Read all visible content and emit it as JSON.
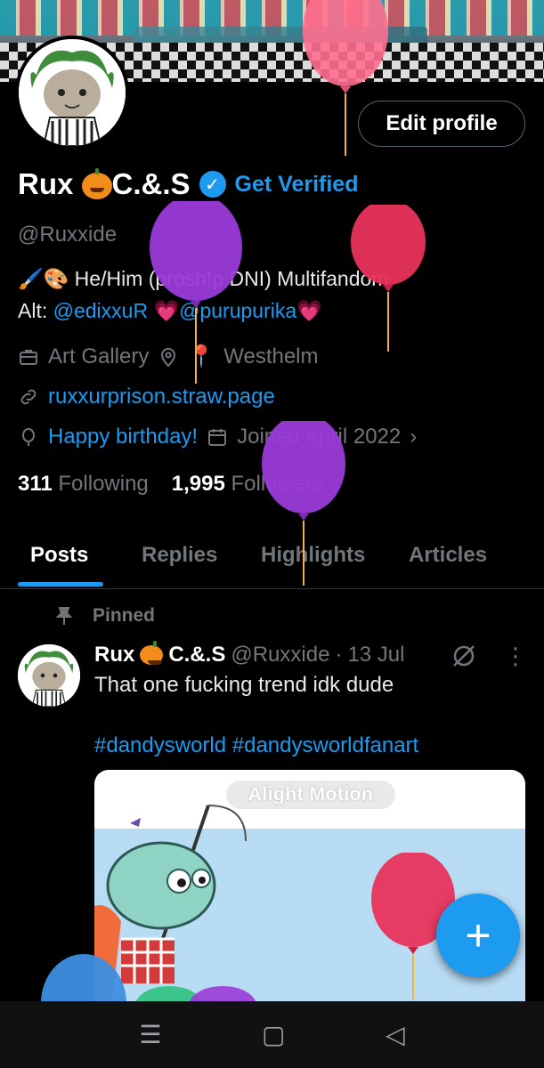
{
  "header": {
    "edit_profile_label": "Edit profile"
  },
  "profile": {
    "name_part1": "Rux",
    "name_part2": "C.&.S",
    "get_verified": "Get Verified",
    "handle": "@Ruxxide",
    "bio_line1": "He/Him (prosh!p DNI) Multifandom",
    "bio_alt_prefix": "Alt:",
    "bio_alt1": "@edixxuR",
    "bio_alt2": "@purupurika",
    "category": "Art Gallery",
    "location": "Westhelm",
    "website": "ruxxurprison.straw.page",
    "birthday": "Happy birthday!",
    "joined": "Joined April 2022",
    "following_count": "311",
    "following_label": "Following",
    "followers_count": "1,995",
    "followers_label": "Followers"
  },
  "tabs": [
    {
      "label": "Posts",
      "active": true
    },
    {
      "label": "Replies"
    },
    {
      "label": "Highlights"
    },
    {
      "label": "Articles"
    }
  ],
  "post": {
    "pinned_label": "Pinned",
    "author_name1": "Rux",
    "author_name2": "C.&.S",
    "author_handle": "@Ruxxide",
    "separator": "·",
    "date": "13 Jul",
    "text": "That one fucking trend idk dude",
    "hashtags": "#dandysworld #dandysworldfanart",
    "media_watermark": "Alight Motion"
  },
  "fab": {
    "label": "+"
  },
  "colors": {
    "accent": "#1d9bf0",
    "background": "#000000",
    "muted": "#71767b"
  }
}
